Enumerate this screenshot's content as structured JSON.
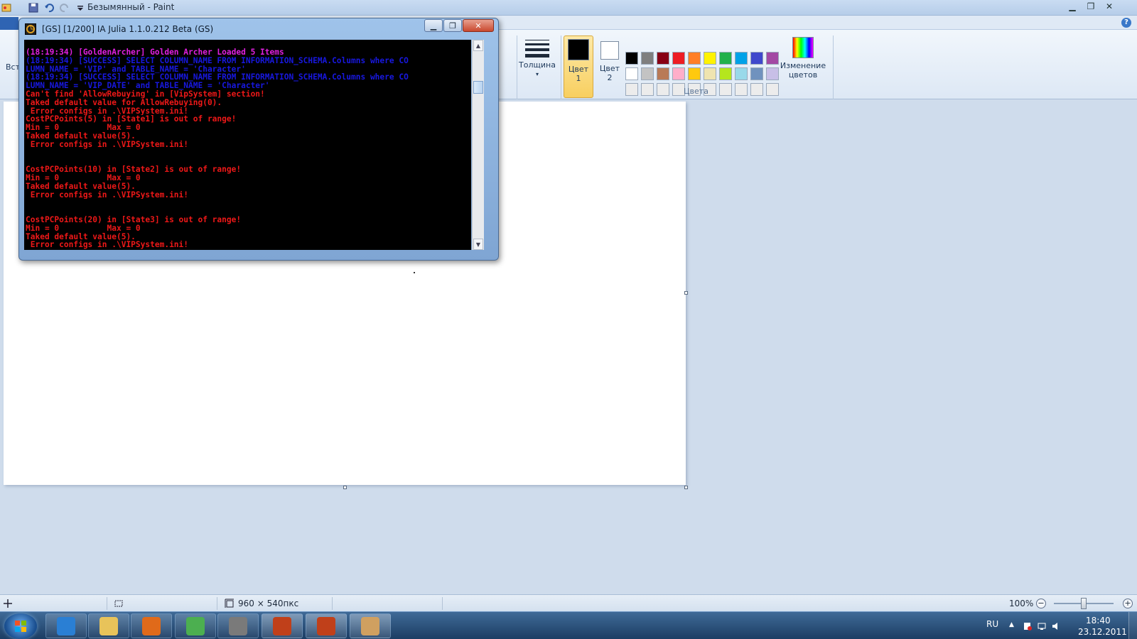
{
  "paint": {
    "title": "Безымянный - Paint",
    "ribbon": {
      "partial_label": "Вст",
      "thickness_label": "Толщина",
      "color1_label": "Цвет\n1",
      "color1_line1": "Цвет",
      "color1_line2": "1",
      "color2_line1": "Цвет",
      "color2_line2": "2",
      "edit_colors_line1": "Изменение",
      "edit_colors_line2": "цветов",
      "group_colors_label": "Цвета",
      "color1_value": "#000000",
      "color2_value": "#ffffff",
      "palette": [
        "#000000",
        "#7f7f7f",
        "#880015",
        "#ed1c24",
        "#ff7f27",
        "#fff200",
        "#22b14c",
        "#00a2e8",
        "#3f48cc",
        "#a349a4",
        "#ffffff",
        "#c3c3c3",
        "#b97a57",
        "#ffaec9",
        "#ffc90e",
        "#efe4b0",
        "#b5e61d",
        "#99d9ea",
        "#7092be",
        "#c8bfe7",
        "#ececec",
        "#ececec",
        "#ececec",
        "#ececec",
        "#ececec",
        "#ececec",
        "#ececec",
        "#ececec",
        "#ececec",
        "#ececec"
      ]
    },
    "status": {
      "canvas_size": "960 × 540пкс",
      "zoom": "100%",
      "zoom_level": 0.5
    }
  },
  "console": {
    "title": "[GS] [1/200] IA Julia 1.1.0.212 Beta (GS)",
    "lines": [
      {
        "text": "(18:19:34) [GoldenArcher] Golden Archer Loaded 5 Items",
        "color": "magenta"
      },
      {
        "text": "(18:19:34) [SUCCESS] SELECT COLUMN_NAME FROM INFORMATION_SCHEMA.Columns where CO",
        "color": "blue"
      },
      {
        "text": "LUMN_NAME = 'VIP' and TABLE_NAME = 'Character'",
        "color": "blue"
      },
      {
        "text": "(18:19:34) [SUCCESS] SELECT COLUMN_NAME FROM INFORMATION_SCHEMA.Columns where CO",
        "color": "blue"
      },
      {
        "text": "LUMN_NAME = 'VIP_DATE' and TABLE_NAME = 'Character'",
        "color": "blue"
      },
      {
        "text": "Can't find 'AllowRebuying' in [VipSystem] section!",
        "color": "red"
      },
      {
        "text": "Taked default value for AllowRebuying(0).",
        "color": "red"
      },
      {
        "text": " Error configs in .\\VIPSystem.ini!",
        "color": "red"
      },
      {
        "text": "CostPCPoints(5) in [State1] is out of range!",
        "color": "red"
      },
      {
        "text": "Min = 0          Max = 0",
        "color": "red"
      },
      {
        "text": "Taked default value(5).",
        "color": "red"
      },
      {
        "text": " Error configs in .\\VIPSystem.ini!",
        "color": "red"
      },
      {
        "text": "",
        "color": "red"
      },
      {
        "text": "",
        "color": "red"
      },
      {
        "text": "CostPCPoints(10) in [State2] is out of range!",
        "color": "red"
      },
      {
        "text": "Min = 0          Max = 0",
        "color": "red"
      },
      {
        "text": "Taked default value(5).",
        "color": "red"
      },
      {
        "text": " Error configs in .\\VIPSystem.ini!",
        "color": "red"
      },
      {
        "text": "",
        "color": "red"
      },
      {
        "text": "",
        "color": "red"
      },
      {
        "text": "CostPCPoints(20) in [State3] is out of range!",
        "color": "red"
      },
      {
        "text": "Min = 0          Max = 0",
        "color": "red"
      },
      {
        "text": "Taked default value(5).",
        "color": "red"
      },
      {
        "text": " Error configs in .\\VIPSystem.ini!",
        "color": "red"
      }
    ]
  },
  "taskbar": {
    "apps": [
      {
        "name": "internet-explorer",
        "color": "#2a7fd4"
      },
      {
        "name": "windows-explorer",
        "color": "#e8c35a"
      },
      {
        "name": "media-player",
        "color": "#e06a1a"
      },
      {
        "name": "chrome",
        "color": "#4caf50"
      },
      {
        "name": "box-app",
        "color": "#7a7a7a"
      },
      {
        "name": "game-server-1",
        "color": "#c0401a"
      },
      {
        "name": "game-server-2",
        "color": "#c0401a"
      },
      {
        "name": "paint",
        "color": "#d0a060"
      }
    ],
    "tray": {
      "language": "RU",
      "time": "18:40",
      "date": "23.12.2011"
    }
  }
}
